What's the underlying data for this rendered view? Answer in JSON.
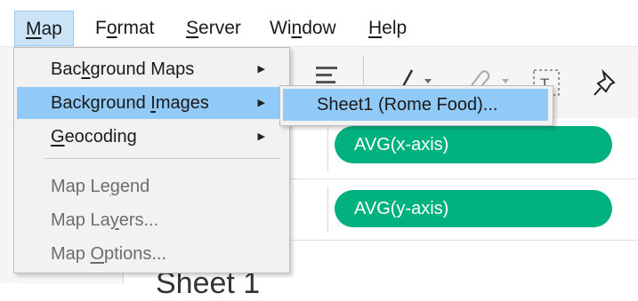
{
  "menubar": {
    "items": [
      {
        "id": "map",
        "label": "Map",
        "prefix": "",
        "ul": "M",
        "rest": "ap"
      },
      {
        "id": "format",
        "label": "Format",
        "prefix": "F",
        "ul": "o",
        "rest": "rmat"
      },
      {
        "id": "server",
        "label": "Server",
        "prefix": "",
        "ul": "S",
        "rest": "erver"
      },
      {
        "id": "window",
        "label": "Window",
        "prefix": "Wi",
        "ul": "n",
        "rest": "dow"
      },
      {
        "id": "help",
        "label": "Help",
        "prefix": "",
        "ul": "H",
        "rest": "elp"
      }
    ]
  },
  "map_menu": {
    "items": [
      {
        "prefix": "Bac",
        "ul": "k",
        "rest": "ground Maps",
        "has_submenu": true,
        "enabled": true
      },
      {
        "prefix": "Background ",
        "ul": "I",
        "rest": "mages",
        "has_submenu": true,
        "enabled": true,
        "highlighted": true
      },
      {
        "prefix": "",
        "ul": "G",
        "rest": "eocoding",
        "has_submenu": true,
        "enabled": true
      },
      {
        "prefix": "Map Le",
        "ul": "g",
        "rest": "end",
        "has_submenu": false,
        "enabled": false
      },
      {
        "prefix": "Map La",
        "ul": "y",
        "rest": "ers...",
        "has_submenu": false,
        "enabled": false
      },
      {
        "prefix": "Map ",
        "ul": "O",
        "rest": "ptions...",
        "has_submenu": false,
        "enabled": false
      }
    ],
    "submenu_arrow": "▶"
  },
  "background_images_submenu": {
    "items": [
      {
        "label": "Sheet1 (Rome Food)..."
      }
    ]
  },
  "shelves": {
    "columns_pill": "AVG(x-axis)",
    "rows_pill": "AVG(y-axis)",
    "pill_color": "#00b180"
  },
  "toolbar": {
    "icons": [
      "sort-icon",
      "pen-icon",
      "paperclip-icon",
      "text-box-icon",
      "pin-icon"
    ]
  },
  "sheet": {
    "title_partial": "Sheet 1"
  }
}
